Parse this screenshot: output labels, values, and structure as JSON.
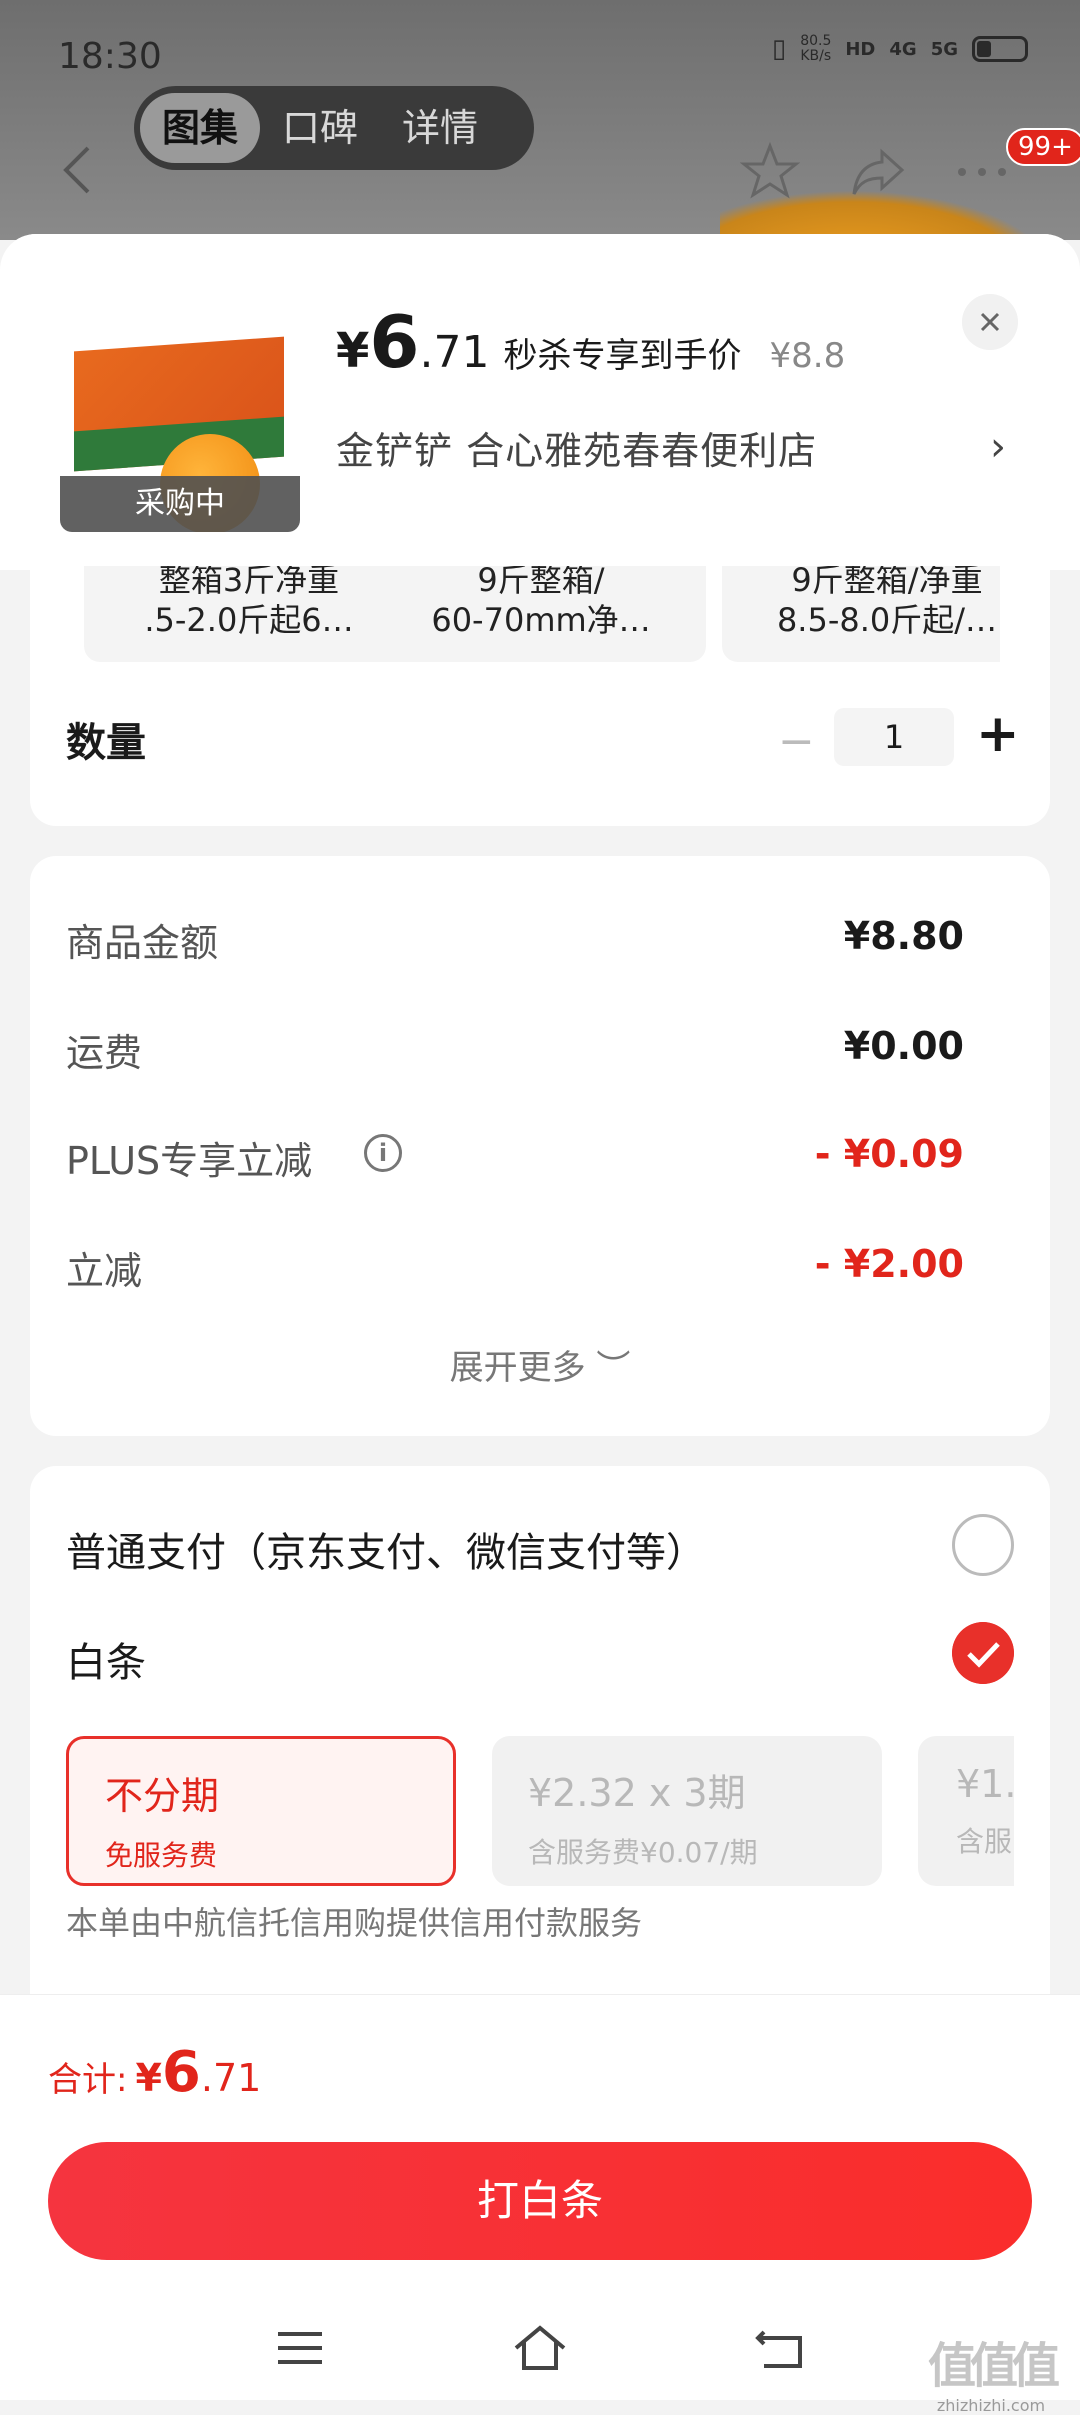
{
  "status_bar": {
    "time": "18:30",
    "net_speed": "80.5",
    "net_unit": "KB/s",
    "signal1": "HD",
    "signal2": "4G",
    "signal3": "5G"
  },
  "top_tabs": [
    "图集",
    "口碑",
    "详情"
  ],
  "top_badge": "99+",
  "product": {
    "status_label": "采购中",
    "price_yen": "¥",
    "price_int": "6",
    "price_dec": ".71",
    "price_tag": "秒杀专享到手价",
    "price_original": "¥8.8",
    "shop_name": "金铲铲  合心雅苑春春便利店",
    "shop_arrow": "›"
  },
  "specs": [
    {
      "line1": "整箱3斤净重",
      "line2": ".5-2.0斤起6…"
    },
    {
      "line1": "9斤整箱/",
      "line2": "60-70mm净…"
    },
    {
      "line1": "9斤整箱/净重",
      "line2": "8.5-8.0斤起/…"
    }
  ],
  "quantity": {
    "label": "数量",
    "minus": "−",
    "value": "1",
    "plus": "+"
  },
  "fees": {
    "items": [
      {
        "label": "商品金额",
        "value": "¥8.80"
      },
      {
        "label": "运费",
        "value": "¥0.00"
      },
      {
        "label": "PLUS专享立减",
        "value": "- ¥0.09"
      },
      {
        "label": "立减",
        "value": "- ¥2.00"
      }
    ],
    "info_icon": "i",
    "expand_label": "展开更多 ︶",
    "accent_color": "#e1251b"
  },
  "payment": {
    "option_normal": "普通支付（京东支付、微信支付等）",
    "option_baitiao": "白条",
    "plans": [
      {
        "title": "不分期",
        "subtitle": "免服务费"
      },
      {
        "title": "¥2.32 x 3期",
        "subtitle": "含服务费¥0.07/期"
      },
      {
        "title": "¥1.",
        "subtitle": "含服"
      }
    ],
    "note": "本单由中航信托信用购提供信用付款服务"
  },
  "footer": {
    "total_label": "合计:",
    "total_yen": "¥",
    "total_int": "6",
    "total_dec": ".71",
    "cta_label": "打白条"
  },
  "watermark": {
    "big": "值值值",
    "small": "zhizhizhi.com"
  },
  "icons": [
    "back-icon",
    "star-icon",
    "share-icon",
    "more-icon",
    "close-icon",
    "info-icon",
    "check-icon",
    "menu-icon",
    "home-icon",
    "return-icon"
  ]
}
